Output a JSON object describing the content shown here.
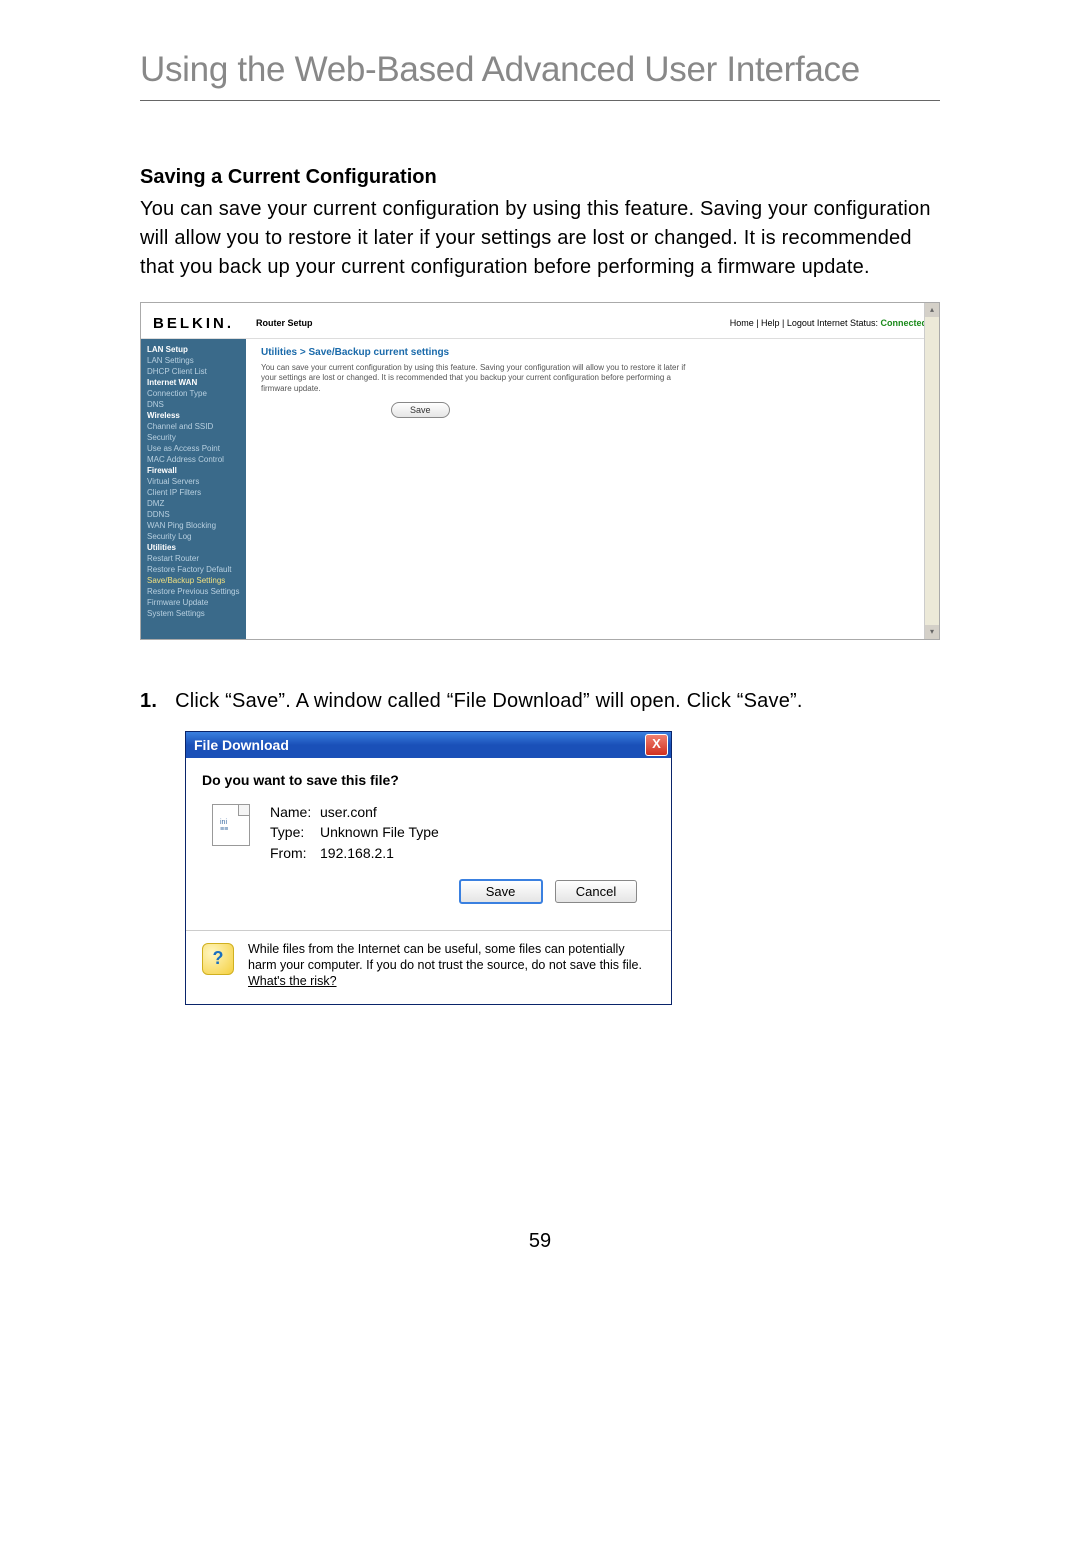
{
  "page_title": "Using the Web-Based Advanced User Interface",
  "section_heading": "Saving a Current Configuration",
  "body_text": "You can save your current configuration by using this feature. Saving your configuration will allow you to restore it later if your settings are lost or changed. It is recommended that you back up your current configuration before performing a firmware update.",
  "router": {
    "brand": "BELKIN",
    "subtitle": "Router Setup",
    "status_links": "Home | Help | Logout    Internet Status:",
    "status_conn": "Connected",
    "breadcrumb": "Utilities > Save/Backup current settings",
    "desc": "You can save your current configuration by using this feature. Saving your configuration will allow you to restore it later if your settings are lost or changed. It is recommended that you backup your current configuration before performing a firmware update.",
    "save_label": "Save",
    "sidebar": [
      {
        "label": "LAN Setup",
        "cls": "sb-head"
      },
      {
        "label": "LAN Settings",
        "cls": ""
      },
      {
        "label": "DHCP Client List",
        "cls": ""
      },
      {
        "label": "Internet WAN",
        "cls": "sb-head"
      },
      {
        "label": "Connection Type",
        "cls": ""
      },
      {
        "label": "DNS",
        "cls": ""
      },
      {
        "label": "Wireless",
        "cls": "sb-head"
      },
      {
        "label": "Channel and SSID",
        "cls": ""
      },
      {
        "label": "Security",
        "cls": ""
      },
      {
        "label": "Use as Access Point",
        "cls": ""
      },
      {
        "label": "MAC Address Control",
        "cls": ""
      },
      {
        "label": "Firewall",
        "cls": "sb-head"
      },
      {
        "label": "Virtual Servers",
        "cls": ""
      },
      {
        "label": "Client IP Filters",
        "cls": ""
      },
      {
        "label": "DMZ",
        "cls": ""
      },
      {
        "label": "DDNS",
        "cls": ""
      },
      {
        "label": "WAN Ping Blocking",
        "cls": ""
      },
      {
        "label": "Security Log",
        "cls": ""
      },
      {
        "label": "Utilities",
        "cls": "sb-head"
      },
      {
        "label": "Restart Router",
        "cls": ""
      },
      {
        "label": "Restore Factory Default",
        "cls": ""
      },
      {
        "label": "Save/Backup Settings",
        "cls": "sb-active"
      },
      {
        "label": "Restore Previous Settings",
        "cls": ""
      },
      {
        "label": "Firmware Update",
        "cls": ""
      },
      {
        "label": "System Settings",
        "cls": ""
      }
    ]
  },
  "step1_num": "1.",
  "step1_text": "Click “Save”. A window called “File Download” will open. Click “Save”.",
  "dialog": {
    "title": "File Download",
    "close": "X",
    "question": "Do you want to save this file?",
    "name_lbl": "Name:",
    "name_val": "user.conf",
    "type_lbl": "Type:",
    "type_val": "Unknown File Type",
    "from_lbl": "From:",
    "from_val": "192.168.2.1",
    "save_btn": "Save",
    "cancel_btn": "Cancel",
    "warn_icon": "?",
    "footer_text": "While files from the Internet can be useful, some files can potentially harm your computer. If you do not trust the source, do not save this file. ",
    "footer_link": "What's the risk?"
  },
  "page_number": "59"
}
